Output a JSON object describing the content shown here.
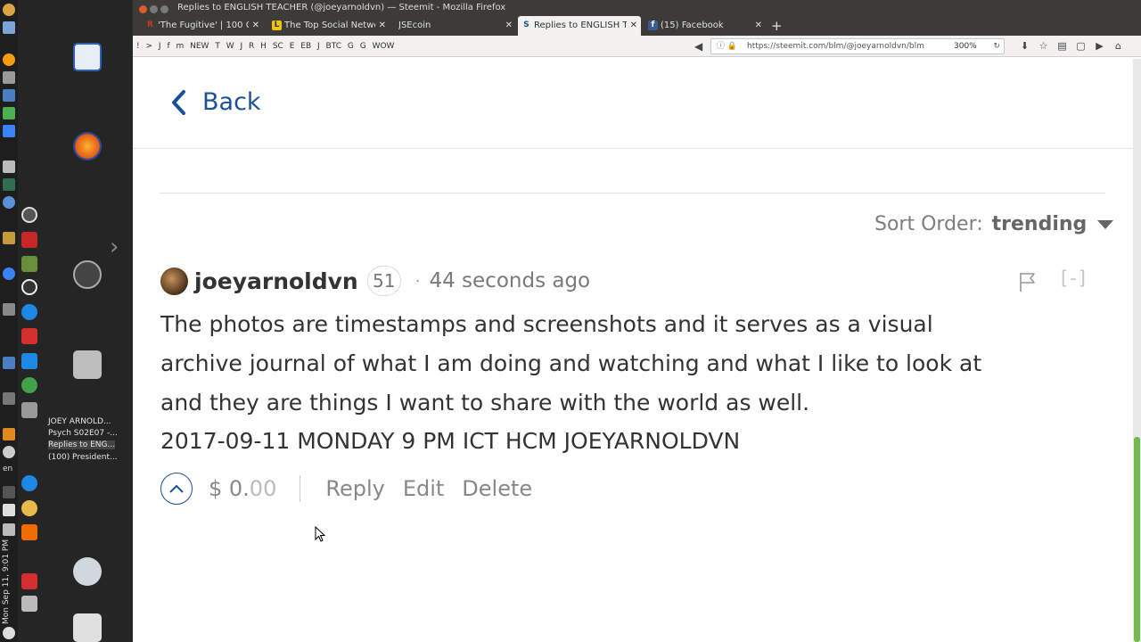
{
  "window": {
    "title": "Replies to ENGLISH TEACHER (@joeyarnoldvn) — Steemit - Mozilla Firefox"
  },
  "tabs": [
    {
      "label": "'The Fugitive' | 100 Gr",
      "favicon": "R"
    },
    {
      "label": "The Top Social Netwo",
      "favicon": "L"
    },
    {
      "label": "JSEcoin",
      "favicon": ""
    },
    {
      "label": "Replies to ENGLISH TE",
      "favicon": "S",
      "active": true
    },
    {
      "label": "(15) Facebook",
      "favicon": "f"
    }
  ],
  "bookmarks": [
    "!",
    ">",
    "J",
    "f",
    "m",
    "NEW",
    "T",
    "W",
    "J",
    "R",
    "H",
    "SC",
    "E",
    "EB",
    "J",
    "BTC",
    "G",
    "G",
    "WOW"
  ],
  "urlbar": {
    "url": "https://steemit.com/blm/@joeyarnoldvn/blm",
    "zoom": "300%"
  },
  "launcher_windows": [
    {
      "label": "JOEY ARNOLD..."
    },
    {
      "label": "Psych S02E07 -..."
    },
    {
      "label": "Replies to ENG...",
      "selected": true
    },
    {
      "label": "(100) President..."
    }
  ],
  "tray": {
    "clock": "Mon Sep 11, 9:01 PM",
    "lang": "en"
  },
  "page": {
    "back_label": "Back",
    "sort_label": "Sort Order:",
    "sort_value": "trending"
  },
  "comment": {
    "author": "joeyarnoldvn",
    "reputation": "51",
    "time_ago": "44 seconds ago",
    "collapse": "[-]",
    "body": "The photos are timestamps and screenshots and it serves as a visual archive journal of what I am doing and watching and what I like to look at and they are things I want to share with the world as well.",
    "stamp": "2017-09-11 MONDAY 9 PM ICT HCM JOEYARNOLDVN",
    "payout_dollars": "$ 0.",
    "payout_cents": "00",
    "actions": {
      "reply": "Reply",
      "edit": "Edit",
      "delete": "Delete"
    }
  },
  "colors": {
    "link": "#1a5099",
    "text": "#333333",
    "muted": "#888888"
  }
}
